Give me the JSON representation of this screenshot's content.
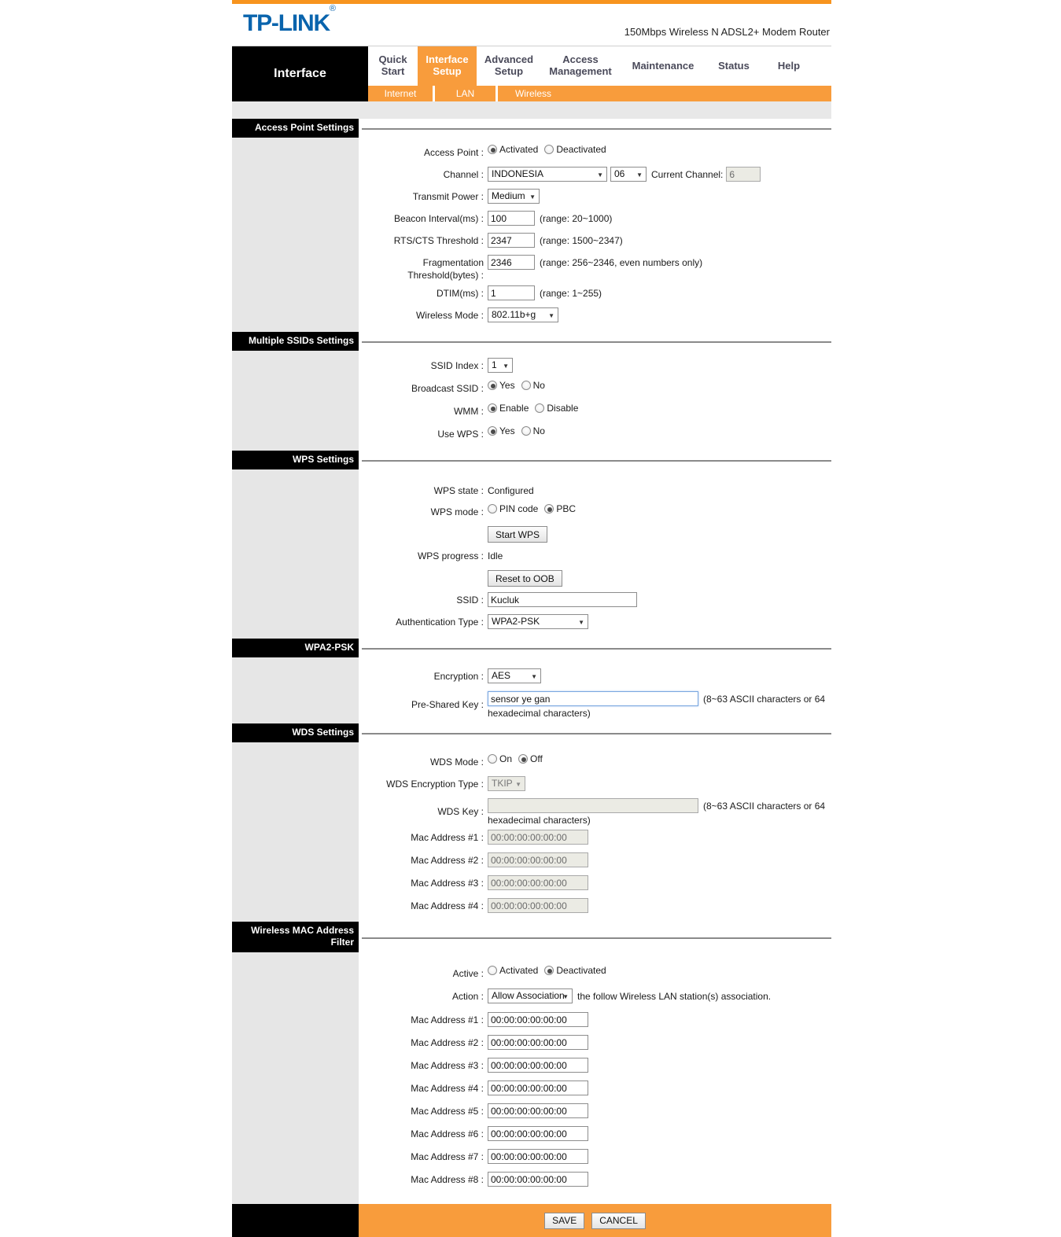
{
  "header": {
    "logo": "TP-LINK",
    "logo_mark": "®",
    "model": "150Mbps Wireless N ADSL2+ Modem Router"
  },
  "nav": {
    "brand": "Interface",
    "tabs": [
      {
        "label": "Quick\nStart",
        "active": false
      },
      {
        "label": "Interface\nSetup",
        "active": true
      },
      {
        "label": "Advanced\nSetup",
        "active": false
      },
      {
        "label": "Access\nManagement",
        "active": false
      },
      {
        "label": "Maintenance",
        "active": false
      },
      {
        "label": "Status",
        "active": false
      },
      {
        "label": "Help",
        "active": false
      }
    ],
    "subtabs": [
      {
        "label": "Internet"
      },
      {
        "label": "LAN"
      },
      {
        "label": "Wireless"
      }
    ]
  },
  "sections": {
    "access_point": {
      "title": "Access Point Settings",
      "access_point_label": "Access Point :",
      "access_point_options": [
        "Activated",
        "Deactivated"
      ],
      "access_point_value": "Activated",
      "channel_label": "Channel :",
      "channel_country": "INDONESIA",
      "channel_number": "06",
      "current_channel_label": "Current Channel:",
      "current_channel_value": "6",
      "transmit_power_label": "Transmit Power :",
      "transmit_power_value": "Medium",
      "beacon_label": "Beacon Interval(ms) :",
      "beacon_value": "100",
      "beacon_hint": "(range: 20~1000)",
      "rts_label": "RTS/CTS Threshold :",
      "rts_value": "2347",
      "rts_hint": "(range: 1500~2347)",
      "frag_label": "Fragmentation\nThreshold(bytes) :",
      "frag_value": "2346",
      "frag_hint": "(range: 256~2346, even numbers only)",
      "dtim_label": "DTIM(ms) :",
      "dtim_value": "1",
      "dtim_hint": "(range: 1~255)",
      "wireless_mode_label": "Wireless Mode :",
      "wireless_mode_value": "802.11b+g"
    },
    "multiple_ssids": {
      "title": "Multiple SSIDs Settings",
      "ssid_index_label": "SSID Index :",
      "ssid_index_value": "1",
      "broadcast_label": "Broadcast SSID :",
      "broadcast_options": [
        "Yes",
        "No"
      ],
      "broadcast_value": "Yes",
      "wmm_label": "WMM :",
      "wmm_options": [
        "Enable",
        "Disable"
      ],
      "wmm_value": "Enable",
      "use_wps_label": "Use WPS :",
      "use_wps_options": [
        "Yes",
        "No"
      ],
      "use_wps_value": "Yes"
    },
    "wps": {
      "title": "WPS Settings",
      "state_label": "WPS state :",
      "state_value": "Configured",
      "mode_label": "WPS mode :",
      "mode_options": [
        "PIN code",
        "PBC"
      ],
      "mode_value": "PBC",
      "start_button": "Start WPS",
      "progress_label": "WPS progress :",
      "progress_value": "Idle",
      "reset_button": "Reset to OOB",
      "ssid_label": "SSID :",
      "ssid_value": "Kucluk",
      "auth_label": "Authentication Type :",
      "auth_value": "WPA2-PSK"
    },
    "wpa2psk": {
      "title": "WPA2-PSK",
      "encryption_label": "Encryption :",
      "encryption_value": "AES",
      "psk_label": "Pre-Shared Key :",
      "psk_value": "sensor ye gan",
      "psk_hint_1": "(8~63 ASCII characters or 64",
      "psk_hint_2": "hexadecimal characters)"
    },
    "wds": {
      "title": "WDS Settings",
      "mode_label": "WDS Mode :",
      "mode_options": [
        "On",
        "Off"
      ],
      "mode_value": "Off",
      "enc_type_label": "WDS Encryption Type :",
      "enc_type_value": "TKIP",
      "key_label": "WDS Key :",
      "key_value": "",
      "key_hint_1": "(8~63 ASCII characters or 64",
      "key_hint_2": "hexadecimal characters)",
      "mac_rows": [
        {
          "label": "Mac Address #1 :",
          "value": "00:00:00:00:00:00"
        },
        {
          "label": "Mac Address #2 :",
          "value": "00:00:00:00:00:00"
        },
        {
          "label": "Mac Address #3 :",
          "value": "00:00:00:00:00:00"
        },
        {
          "label": "Mac Address #4 :",
          "value": "00:00:00:00:00:00"
        }
      ]
    },
    "mac_filter": {
      "title": "Wireless MAC Address Filter",
      "active_label": "Active :",
      "active_options": [
        "Activated",
        "Deactivated"
      ],
      "active_value": "Deactivated",
      "action_label": "Action :",
      "action_value": "Allow Association",
      "action_hint": "the follow Wireless LAN station(s) association.",
      "mac_rows": [
        {
          "label": "Mac Address #1 :",
          "value": "00:00:00:00:00:00"
        },
        {
          "label": "Mac Address #2 :",
          "value": "00:00:00:00:00:00"
        },
        {
          "label": "Mac Address #3 :",
          "value": "00:00:00:00:00:00"
        },
        {
          "label": "Mac Address #4 :",
          "value": "00:00:00:00:00:00"
        },
        {
          "label": "Mac Address #5 :",
          "value": "00:00:00:00:00:00"
        },
        {
          "label": "Mac Address #6 :",
          "value": "00:00:00:00:00:00"
        },
        {
          "label": "Mac Address #7 :",
          "value": "00:00:00:00:00:00"
        },
        {
          "label": "Mac Address #8 :",
          "value": "00:00:00:00:00:00"
        }
      ]
    }
  },
  "footer": {
    "save_label": "SAVE",
    "cancel_label": "CANCEL"
  },
  "colors": {
    "orange": "#f89c3c",
    "orange_strip": "#f7941e",
    "brand_blue": "#0a64ad",
    "black": "#000000",
    "left_gray": "#e6e6e6",
    "spacer_gray": "#e8e8e8"
  }
}
